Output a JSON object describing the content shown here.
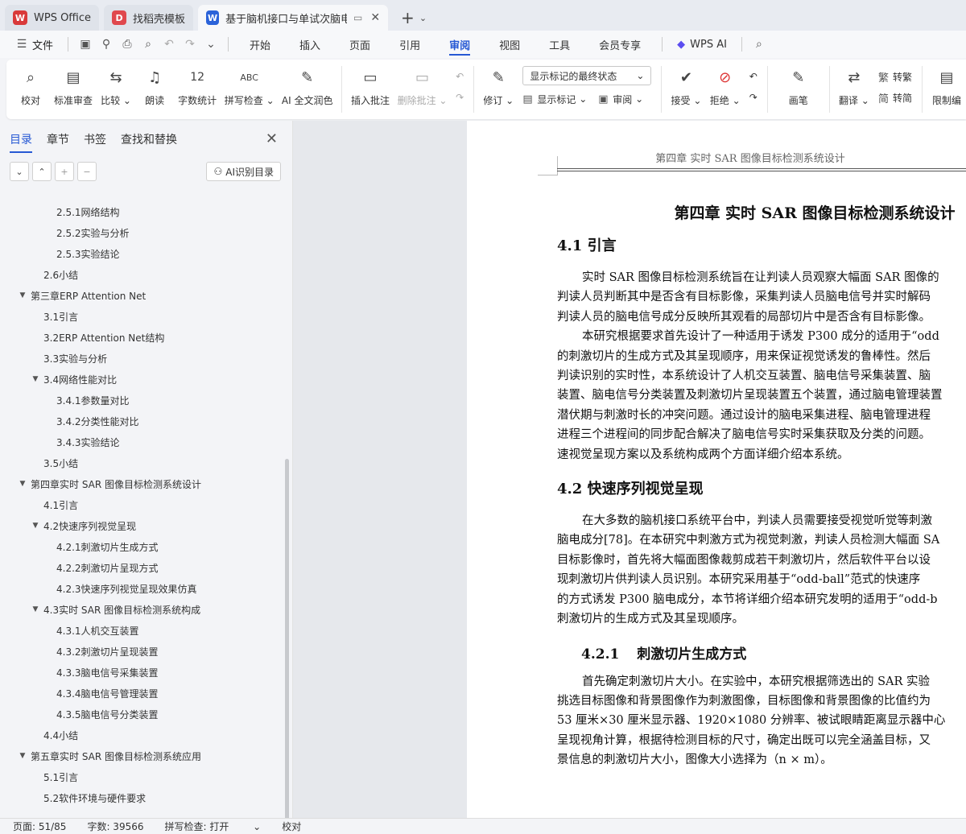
{
  "titlebar": {
    "tabs": [
      {
        "label": "WPS Office",
        "logo": "W",
        "color": "#d93a3a"
      },
      {
        "label": "找稻壳模板",
        "logo": "D",
        "color": "#e0484d"
      },
      {
        "label": "基于脑机接口与单试次脑电分",
        "logo": "W",
        "color": "#2b63d9"
      }
    ],
    "new_tab": "+"
  },
  "menubar": {
    "file_label": "文件",
    "items": [
      "开始",
      "插入",
      "页面",
      "引用",
      "审阅",
      "视图",
      "工具",
      "会员专享"
    ],
    "active": "审阅",
    "wps_ai": "WPS AI"
  },
  "ribbon": {
    "proofread": "校对",
    "standard_review": "标准审查",
    "compare": "比较",
    "read_aloud": "朗读",
    "word_count": "字数统计",
    "spell_check": "拼写检查",
    "ai_polish": "AI 全文润色",
    "insert_comment": "插入批注",
    "delete_comment": "删除批注",
    "markup_select": "显示标记的最终状态",
    "track_changes": "修订",
    "show_markup": "显示标记",
    "review": "审阅",
    "accept": "接受",
    "reject": "拒绝",
    "pen": "画笔",
    "translate": "翻译",
    "to_traditional": "转繁",
    "to_simplified": "转简",
    "restrict": "限制编"
  },
  "nav": {
    "tabs": [
      "目录",
      "章节",
      "书签",
      "查找和替换"
    ],
    "active": "目录",
    "ai_toc": "AI识别目录",
    "toc": [
      {
        "level": 3,
        "text": "2.5.1网络结构",
        "arrow": ""
      },
      {
        "level": 3,
        "text": "2.5.2实验与分析",
        "arrow": ""
      },
      {
        "level": 3,
        "text": "2.5.3实验结论",
        "arrow": ""
      },
      {
        "level": 2,
        "text": "2.6小结",
        "arrow": ""
      },
      {
        "level": 1,
        "text": "第三章ERP Attention Net",
        "arrow": "▼"
      },
      {
        "level": 2,
        "text": "3.1引言",
        "arrow": ""
      },
      {
        "level": 2,
        "text": "3.2ERP Attention Net结构",
        "arrow": ""
      },
      {
        "level": 2,
        "text": "3.3实验与分析",
        "arrow": ""
      },
      {
        "level": 2,
        "text": "3.4网络性能对比",
        "arrow": "▼"
      },
      {
        "level": 3,
        "text": "3.4.1参数量对比",
        "arrow": ""
      },
      {
        "level": 3,
        "text": "3.4.2分类性能对比",
        "arrow": ""
      },
      {
        "level": 3,
        "text": "3.4.3实验结论",
        "arrow": ""
      },
      {
        "level": 2,
        "text": "3.5小结",
        "arrow": ""
      },
      {
        "level": 1,
        "text": "第四章实时 SAR 图像目标检测系统设计",
        "arrow": "▼"
      },
      {
        "level": 2,
        "text": "4.1引言",
        "arrow": ""
      },
      {
        "level": 2,
        "text": "4.2快速序列视觉呈现",
        "arrow": "▼"
      },
      {
        "level": 3,
        "text": "4.2.1刺激切片生成方式",
        "arrow": ""
      },
      {
        "level": 3,
        "text": "4.2.2刺激切片呈现方式",
        "arrow": ""
      },
      {
        "level": 3,
        "text": "4.2.3快速序列视觉呈现效果仿真",
        "arrow": ""
      },
      {
        "level": 2,
        "text": "4.3实时 SAR 图像目标检测系统构成",
        "arrow": "▼"
      },
      {
        "level": 3,
        "text": "4.3.1人机交互装置",
        "arrow": ""
      },
      {
        "level": 3,
        "text": "4.3.2刺激切片呈现装置",
        "arrow": ""
      },
      {
        "level": 3,
        "text": "4.3.3脑电信号采集装置",
        "arrow": ""
      },
      {
        "level": 3,
        "text": "4.3.4脑电信号管理装置",
        "arrow": ""
      },
      {
        "level": 3,
        "text": "4.3.5脑电信号分类装置",
        "arrow": ""
      },
      {
        "level": 2,
        "text": "4.4小结",
        "arrow": ""
      },
      {
        "level": 1,
        "text": "第五章实时 SAR 图像目标检测系统应用",
        "arrow": "▼"
      },
      {
        "level": 2,
        "text": "5.1引言",
        "arrow": ""
      },
      {
        "level": 2,
        "text": "5.2软件环境与硬件要求",
        "arrow": ""
      }
    ]
  },
  "document": {
    "running_header": "第四章  实时 SAR 图像目标检测系统设计",
    "chapter_title": "第四章   实时 SAR 图像目标检测系统设计",
    "sec_4_1": "4.1 引言",
    "para1": [
      "实时 SAR 图像目标检测系统旨在让判读人员观察大幅面 SAR 图像的",
      "判读人员判断其中是否含有目标影像，采集判读人员脑电信号并实时解码",
      "判读人员的脑电信号成分反映所其观看的局部切片中是否含有目标影像。"
    ],
    "para2": [
      "本研究根据要求首先设计了一种适用于诱发 P300 成分的适用于“odd",
      "的刺激切片的生成方式及其呈现顺序，用来保证视觉诱发的鲁棒性。然后",
      "判读识别的实时性，本系统设计了人机交互装置、脑电信号采集装置、脑",
      "装置、脑电信号分类装置及刺激切片呈现装置五个装置，通过脑电管理装置",
      "潜伏期与刺激时长的冲突问题。通过设计的脑电采集进程、脑电管理进程",
      "进程三个进程间的同步配合解决了脑电信号实时采集获取及分类的问题。",
      "速视觉呈现方案以及系统构成两个方面详细介绍本系统。"
    ],
    "sec_4_2": "4.2 快速序列视觉呈现",
    "para3": [
      "在大多数的脑机接口系统平台中，判读人员需要接受视觉听觉等刺激",
      "脑电成分[78]。在本研究中刺激方式为视觉刺激，判读人员检测大幅面 SA",
      "目标影像时，首先将大幅面图像裁剪成若干刺激切片，然后软件平台以设",
      "现刺激切片供判读人员识别。本研究采用基于“odd-ball”范式的快速序",
      "的方式诱发 P300 脑电成分，本节将详细介绍本研究发明的适用于“odd-b",
      "刺激切片的生成方式及其呈现顺序。"
    ],
    "sub_4_2_1_num": "4.2.1",
    "sub_4_2_1_title": "刺激切片生成方式",
    "para4": [
      "首先确定刺激切片大小。在实验中，本研究根据筛选出的 SAR 实验",
      "挑选目标图像和背景图像作为刺激图像，目标图像和背景图像的比值约为",
      "53 厘米×30 厘米显示器、1920×1080 分辨率、被试眼睛距离显示器中心",
      "呈现视角计算，根据待检测目标的尺寸，确定出既可以完全涵盖目标，又",
      "景信息的刺激切片大小，图像大小选择为（n × m）。"
    ]
  },
  "status": {
    "page": "页面: 51/85",
    "words": "字数: 39566",
    "spell": "拼写检查: 打开",
    "proof": "校对"
  }
}
